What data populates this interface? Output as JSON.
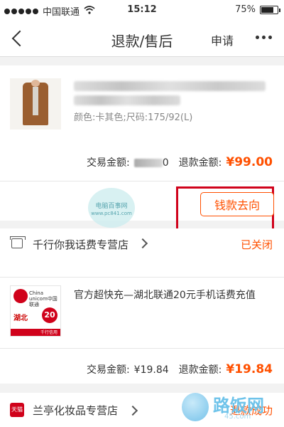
{
  "status_bar": {
    "carrier": "中国联通",
    "time": "15:12",
    "battery": "75%",
    "battery_level": 0.75
  },
  "nav": {
    "title": "退款/售后",
    "apply_label": "申请"
  },
  "order1": {
    "spec": "颜色:卡其色;尺码:175/92(L)",
    "trade_label": "交易金额:",
    "trade_amount_tail": "0",
    "refund_label": "退款金额:",
    "refund_amount": "¥99.00",
    "money_button": "钱款去向"
  },
  "watermark1": {
    "text": "电脑百事网",
    "url": "www.pc841.com"
  },
  "order2": {
    "shop": "千行你我话费专营店",
    "status": "已关闭",
    "title": "官方超快充—湖北联通20元手机话费充值",
    "image": {
      "brand": "China unicom中国联通",
      "province": "湖北",
      "value": "20",
      "strip_text": "千行信用"
    },
    "trade_label": "交易金额:",
    "trade_amount": "¥19.84",
    "refund_label": "退款金额:",
    "refund_amount": "¥19.84"
  },
  "order3": {
    "badge": "天猫",
    "shop": "兰亭化妆品专营店",
    "status": "退款成功"
  },
  "site_watermark": {
    "name": "路饭网",
    "url": "45.com"
  },
  "colors": {
    "accent": "#ff5000",
    "highlight_box": "#d0021b"
  }
}
